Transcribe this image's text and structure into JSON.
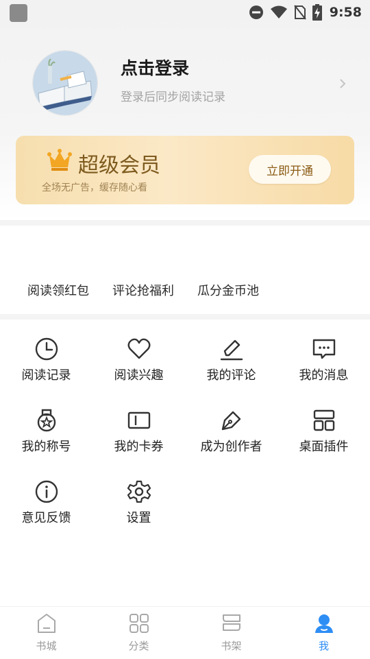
{
  "status_bar": {
    "time": "9:58"
  },
  "profile": {
    "title": "点击登录",
    "subtitle": "登录后同步阅读记录"
  },
  "vip": {
    "title": "超级会员",
    "subtitle": "全场无广告，缓存随心看",
    "button": "立即开通",
    "accent": "#7d5a1e"
  },
  "promo": [
    "阅读领红包",
    "评论抢福利",
    "瓜分金币池"
  ],
  "grid": [
    {
      "label": "阅读记录",
      "icon": "clock-icon"
    },
    {
      "label": "阅读兴趣",
      "icon": "heart-icon"
    },
    {
      "label": "我的评论",
      "icon": "pencil-icon"
    },
    {
      "label": "我的消息",
      "icon": "message-icon"
    },
    {
      "label": "我的称号",
      "icon": "medal-icon"
    },
    {
      "label": "我的卡券",
      "icon": "ticket-icon"
    },
    {
      "label": "成为创作者",
      "icon": "pen-nib-icon"
    },
    {
      "label": "桌面插件",
      "icon": "widget-icon"
    },
    {
      "label": "意见反馈",
      "icon": "info-icon"
    },
    {
      "label": "设置",
      "icon": "gear-icon"
    }
  ],
  "bottom_nav": [
    {
      "label": "书城",
      "icon": "bookstore-icon",
      "active": false
    },
    {
      "label": "分类",
      "icon": "category-icon",
      "active": false
    },
    {
      "label": "书架",
      "icon": "bookshelf-icon",
      "active": false
    },
    {
      "label": "我",
      "icon": "user-icon",
      "active": true
    }
  ],
  "colors": {
    "active_tab": "#2f8ef4",
    "inactive_tab": "#9a9a9a"
  }
}
